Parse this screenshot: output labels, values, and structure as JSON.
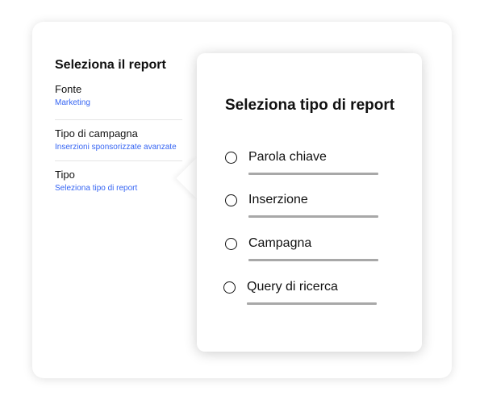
{
  "left_panel": {
    "title": "Seleziona il report",
    "fields": [
      {
        "label": "Fonte",
        "value": "Marketing"
      },
      {
        "label": "Tipo di campagna",
        "value": "Inserzioni sponsorizzate avanzate"
      },
      {
        "label": "Tipo",
        "value": "Seleziona tipo di report"
      }
    ]
  },
  "popup": {
    "title": "Seleziona tipo di report",
    "options": [
      {
        "label": "Parola chiave",
        "selected": false
      },
      {
        "label": "Inserzione",
        "selected": false
      },
      {
        "label": "Campagna",
        "selected": false
      },
      {
        "label": "Query di ricerca",
        "selected": false
      }
    ]
  },
  "colors": {
    "link": "#3665f3",
    "text": "#111111",
    "underline": "#a8a8a8"
  }
}
